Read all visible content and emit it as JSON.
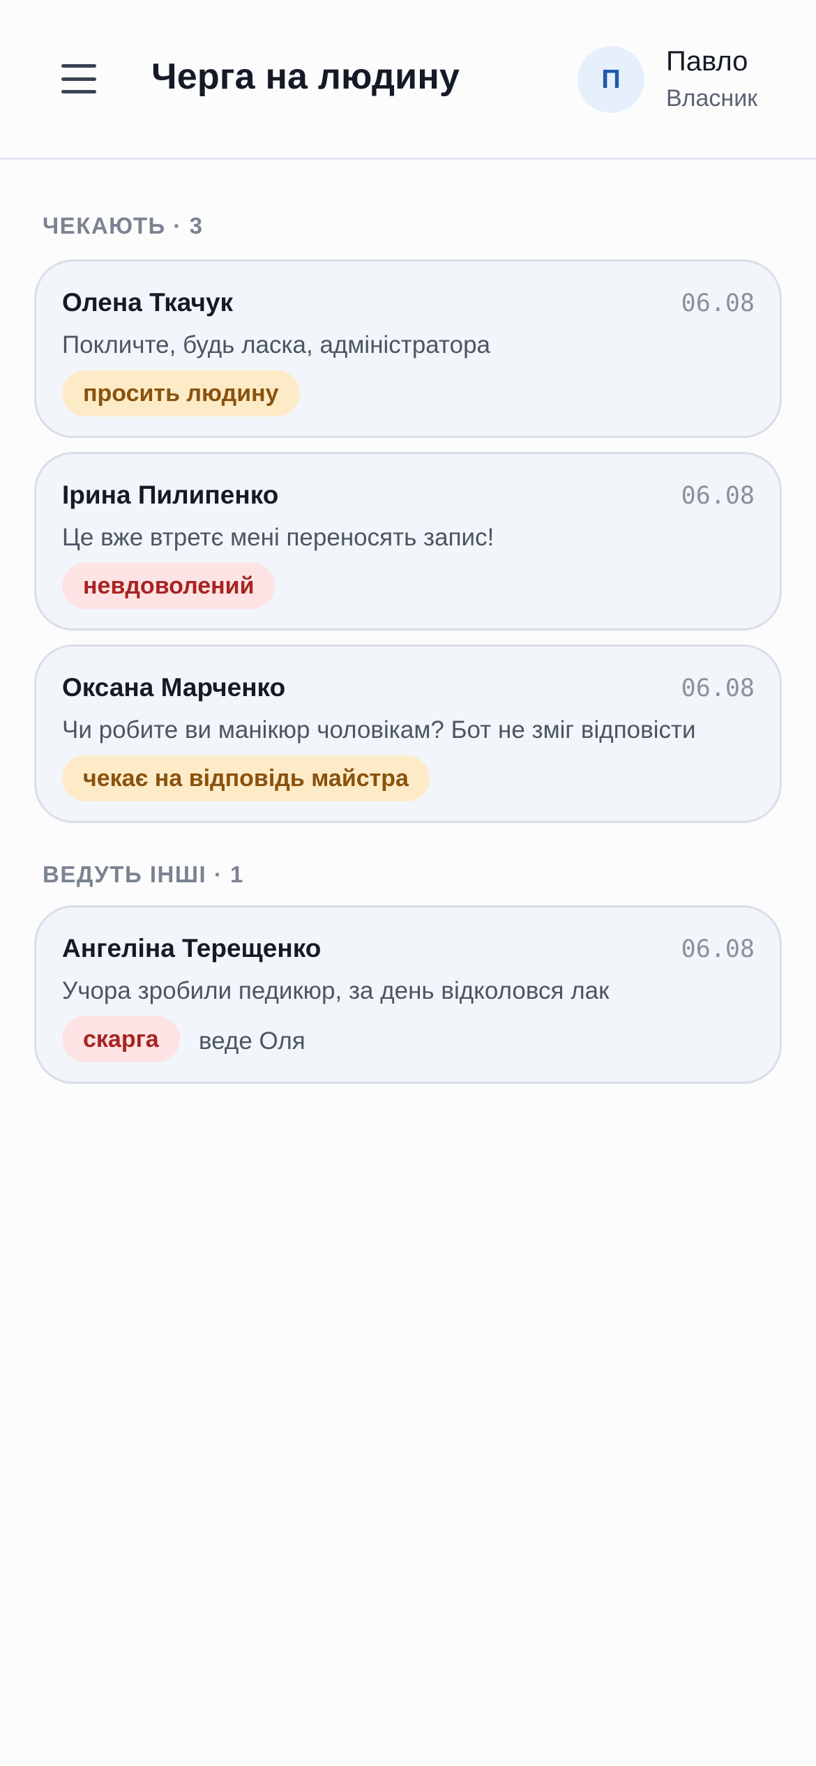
{
  "header": {
    "title": "Черга на людину",
    "menu_icon": "hamburger-menu-icon",
    "user": {
      "avatar_initial": "П",
      "name": "Павло",
      "role": "Власник"
    }
  },
  "sections": [
    {
      "label": "ЧЕКАЮТЬ · 3",
      "items": [
        {
          "name": "Олена Ткачук",
          "date": "06.08",
          "message": "Покличте, будь ласка, адміністратора",
          "tag": "просить людину",
          "tag_color": "#fdebc8"
        },
        {
          "name": "Ірина Пилипенко",
          "date": "06.08",
          "message": "Це вже втретє мені переносять запис!",
          "tag": "невдоволений",
          "tag_color": "#fde3e3"
        },
        {
          "name": "Оксана Марченко",
          "date": "06.08",
          "message": "Чи робите ви манікюр чоловікам? Бот не зміг відповісти",
          "tag": "чекає на відповідь майстра",
          "tag_color": "#fdebc8"
        }
      ]
    },
    {
      "label": "ВЕДУТЬ ІНШІ · 1",
      "items": [
        {
          "name": "Ангеліна Терещенко",
          "date": "06.08",
          "message": "Учора зробили педикюр, за день відколовся лак",
          "tag": "скарга",
          "tag_color": "#fde3e3",
          "handler": "веде Оля"
        }
      ]
    }
  ]
}
